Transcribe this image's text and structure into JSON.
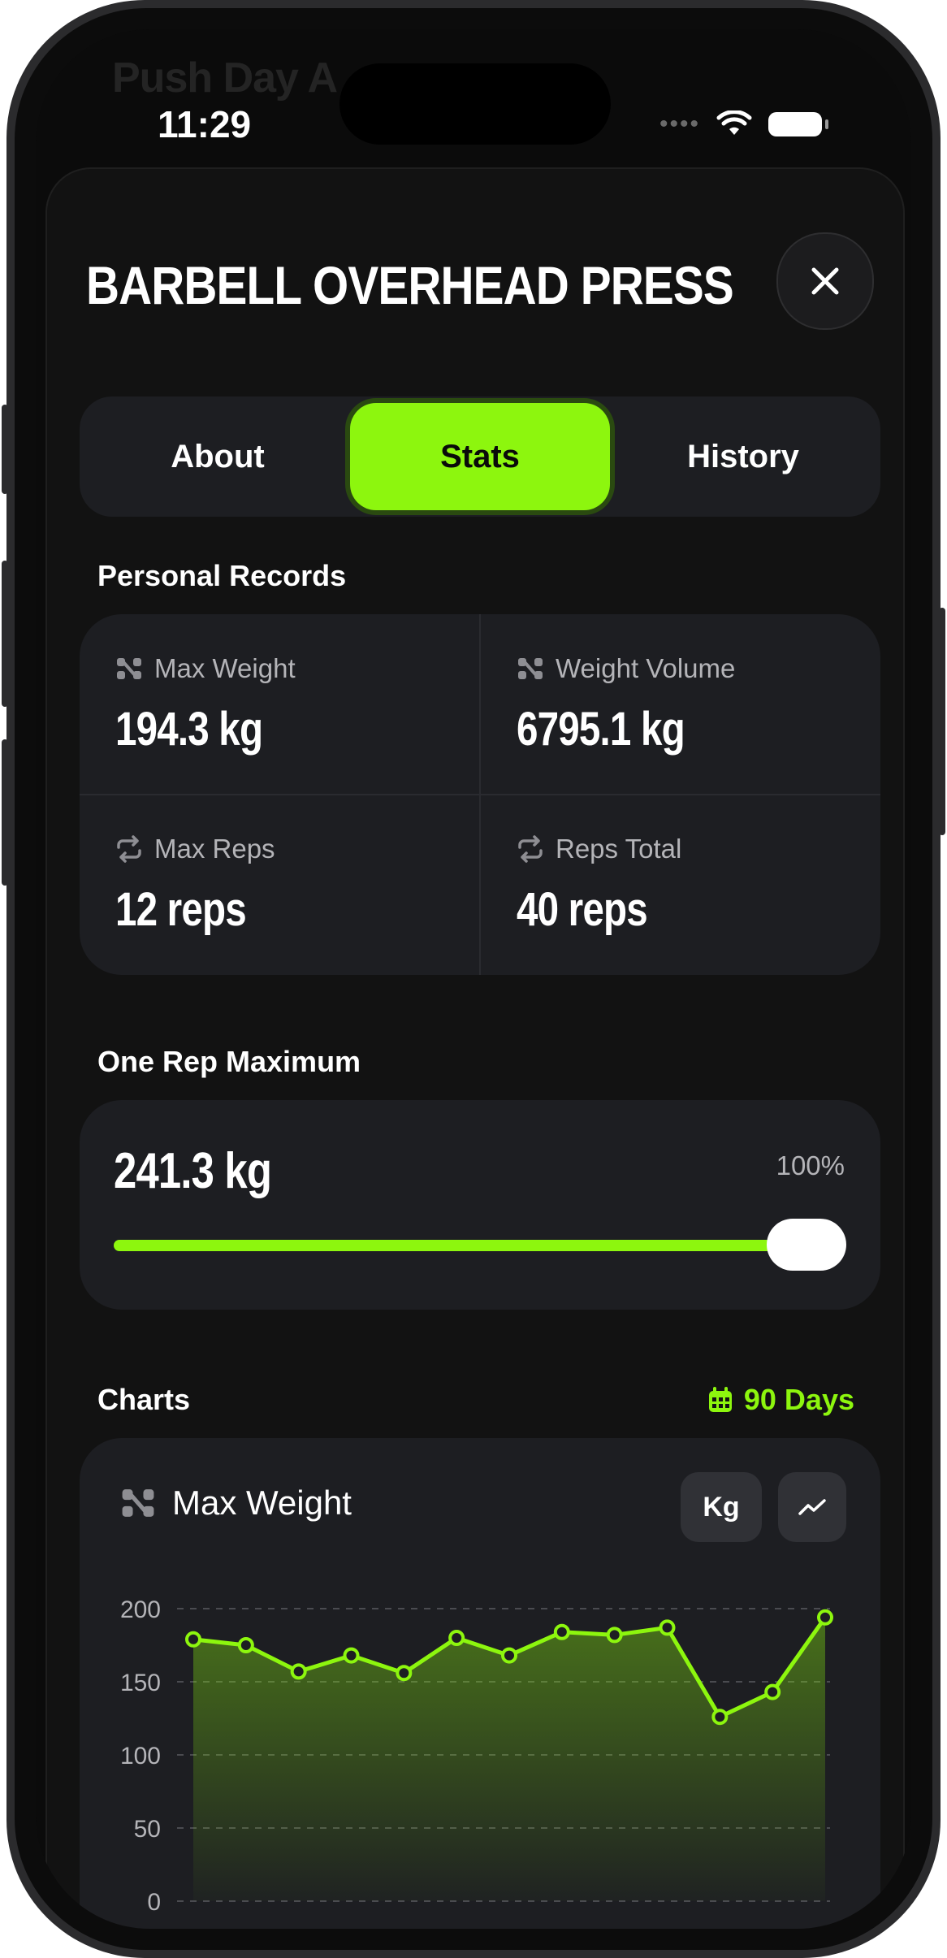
{
  "background_title": "Push Day A",
  "status_bar": {
    "time": "11:29"
  },
  "header": {
    "title": "BARBELL OVERHEAD PRESS"
  },
  "tabs": [
    {
      "label": "About",
      "active": false
    },
    {
      "label": "Stats",
      "active": true
    },
    {
      "label": "History",
      "active": false
    }
  ],
  "personal_records": {
    "heading": "Personal Records",
    "items": [
      {
        "label": "Max Weight",
        "value": "194.3 kg",
        "icon": "dumbbell-icon"
      },
      {
        "label": "Weight Volume",
        "value": "6795.1 kg",
        "icon": "dumbbell-icon"
      },
      {
        "label": "Max Reps",
        "value": "12 reps",
        "icon": "repeat-icon"
      },
      {
        "label": "Reps Total",
        "value": "40 reps",
        "icon": "repeat-icon"
      }
    ]
  },
  "one_rep_max": {
    "heading": "One Rep Maximum",
    "value": "241.3 kg",
    "percent_label": "100%",
    "slider_fraction": 1.0
  },
  "charts": {
    "heading": "Charts",
    "range_label": "90 Days",
    "card_title": "Max Weight",
    "unit_chip": "Kg"
  },
  "colors": {
    "accent": "#8df60e",
    "background": "#0b0b0b",
    "card": "#1d1e22"
  },
  "chart_data": {
    "type": "area",
    "x": [
      1,
      2,
      3,
      4,
      5,
      6,
      7,
      8,
      9,
      10,
      11,
      12,
      13
    ],
    "values": [
      179,
      175,
      157,
      168,
      156,
      180,
      168,
      184,
      182,
      187,
      126,
      143,
      194
    ],
    "yticks": [
      0,
      50,
      100,
      150,
      200
    ],
    "ylim": [
      0,
      200
    ],
    "grid": true
  }
}
